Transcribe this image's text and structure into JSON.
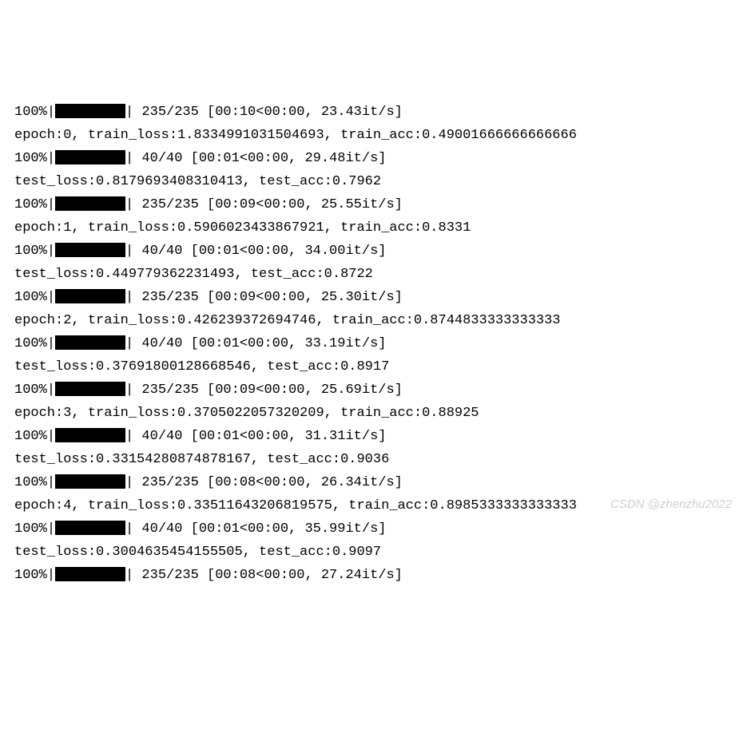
{
  "lines": [
    {
      "type": "progress",
      "percent": "100%",
      "post": " 235/235 [00:10<00:00, 23.43it/s]"
    },
    {
      "type": "text",
      "text": "epoch:0, train_loss:1.8334991031504693, train_acc:0.49001666666666666"
    },
    {
      "type": "progress",
      "percent": "100%",
      "post": " 40/40 [00:01<00:00, 29.48it/s]"
    },
    {
      "type": "text",
      "text": "test_loss:0.8179693408310413, test_acc:0.7962"
    },
    {
      "type": "progress",
      "percent": "100%",
      "post": " 235/235 [00:09<00:00, 25.55it/s]"
    },
    {
      "type": "text",
      "text": "epoch:1, train_loss:0.5906023433867921, train_acc:0.8331"
    },
    {
      "type": "progress",
      "percent": "100%",
      "post": " 40/40 [00:01<00:00, 34.00it/s]"
    },
    {
      "type": "text",
      "text": "test_loss:0.449779362231493, test_acc:0.8722"
    },
    {
      "type": "progress",
      "percent": "100%",
      "post": " 235/235 [00:09<00:00, 25.30it/s]"
    },
    {
      "type": "text",
      "text": "epoch:2, train_loss:0.426239372694746, train_acc:0.8744833333333333"
    },
    {
      "type": "progress",
      "percent": "100%",
      "post": " 40/40 [00:01<00:00, 33.19it/s]"
    },
    {
      "type": "text",
      "text": "test_loss:0.37691800128668546, test_acc:0.8917"
    },
    {
      "type": "progress",
      "percent": "100%",
      "post": " 235/235 [00:09<00:00, 25.69it/s]"
    },
    {
      "type": "text",
      "text": "epoch:3, train_loss:0.3705022057320209, train_acc:0.88925"
    },
    {
      "type": "progress",
      "percent": "100%",
      "post": " 40/40 [00:01<00:00, 31.31it/s]"
    },
    {
      "type": "text",
      "text": "test_loss:0.33154280874878167, test_acc:0.9036"
    },
    {
      "type": "progress",
      "percent": "100%",
      "post": " 235/235 [00:08<00:00, 26.34it/s]"
    },
    {
      "type": "text",
      "text": "epoch:4, train_loss:0.33511643206819575, train_acc:0.8985333333333333"
    },
    {
      "type": "progress",
      "percent": "100%",
      "post": " 40/40 [00:01<00:00, 35.99it/s]"
    },
    {
      "type": "text",
      "text": "test_loss:0.3004635454155505, test_acc:0.9097"
    },
    {
      "type": "progress",
      "percent": "100%",
      "post": " 235/235 [00:08<00:00, 27.24it/s]"
    }
  ],
  "watermark": "CSDN @zhenzhu2022"
}
